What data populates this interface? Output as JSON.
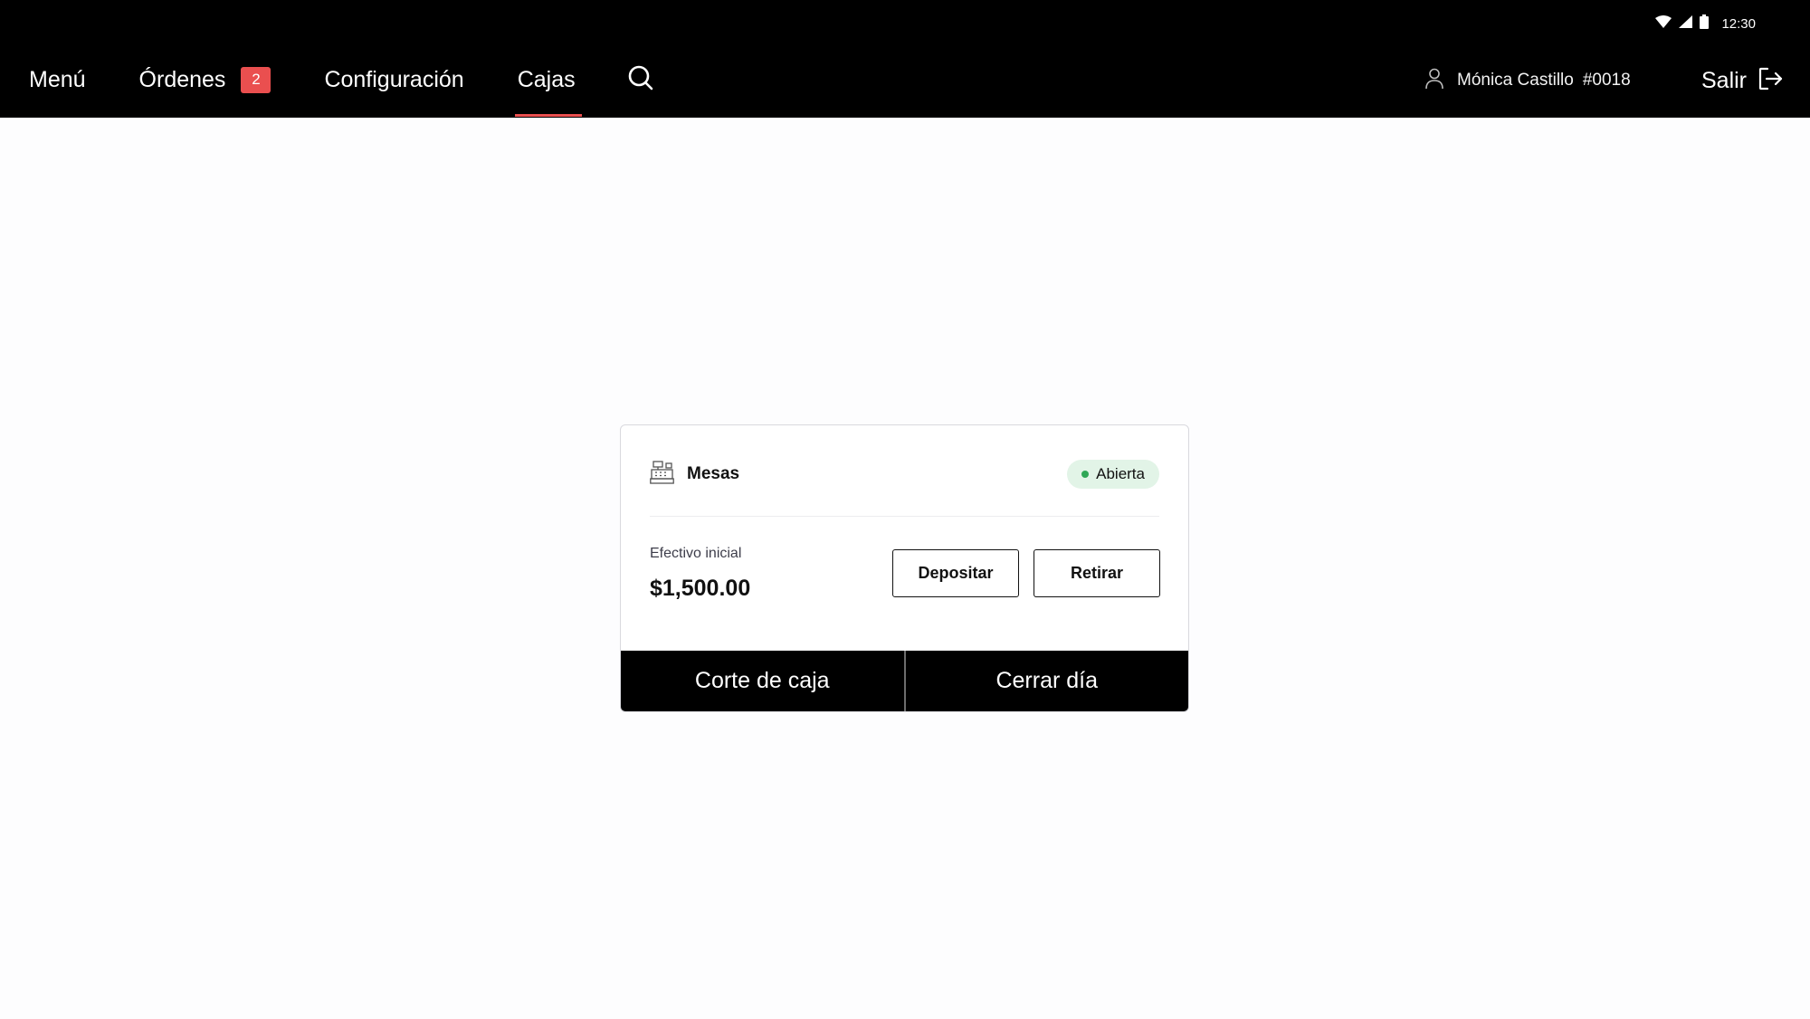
{
  "status_bar": {
    "time": "12:30",
    "icons": [
      "wifi-icon",
      "signal-icon",
      "battery-icon"
    ]
  },
  "nav": {
    "items": [
      {
        "label": "Menú"
      },
      {
        "label": "Órdenes",
        "badge": "2"
      },
      {
        "label": "Configuración"
      },
      {
        "label": "Cajas",
        "active": true
      }
    ],
    "search_icon": "search-icon"
  },
  "user": {
    "name": "Mónica Castillo",
    "id": "#0018",
    "icon": "user-icon"
  },
  "logout": {
    "label": "Salir",
    "icon": "logout-icon"
  },
  "register_card": {
    "title": "Mesas",
    "icon": "cash-register-icon",
    "status": "Abierta",
    "cash_label": "Efectivo inicial",
    "cash_value": "$1,500.00",
    "deposit_label": "Depositar",
    "withdraw_label": "Retirar",
    "cut_label": "Corte de caja",
    "close_day_label": "Cerrar día"
  },
  "colors": {
    "accent": "#ea4f4f",
    "status_open_bg": "#e2f4e7",
    "status_open_dot": "#2fa756",
    "topbar": "#000000"
  }
}
